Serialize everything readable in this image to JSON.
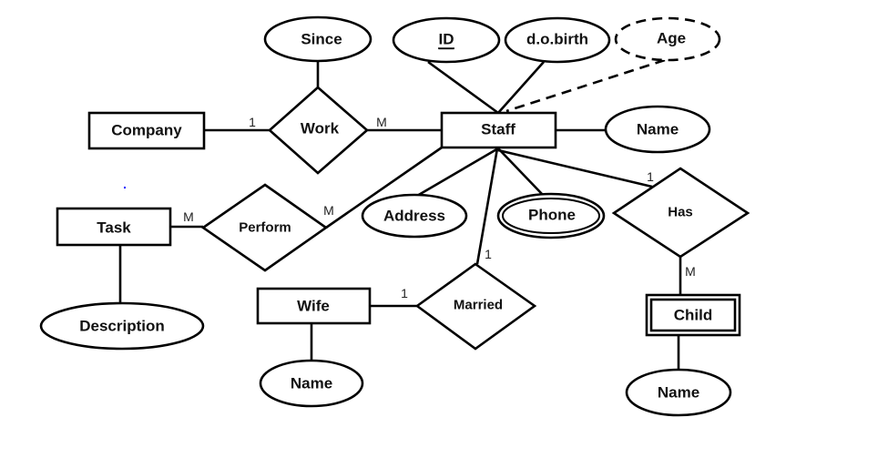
{
  "diagram": {
    "entities": {
      "company": "Company",
      "staff": "Staff",
      "task": "Task",
      "wife": "Wife",
      "child": "Child"
    },
    "relationships": {
      "work": "Work",
      "perform": "Perform",
      "married": "Married",
      "has": "Has"
    },
    "attributes": {
      "since": "Since",
      "id": "ID",
      "dob": "d.o.birth",
      "age": "Age",
      "staff_name": "Name",
      "address": "Address",
      "phone": "Phone",
      "description": "Description",
      "wife_name": "Name",
      "child_name": "Name"
    },
    "cardinalities": {
      "company_work": "1",
      "work_staff": "M",
      "task_perform": "M",
      "perform_staff": "M",
      "wife_married": "1",
      "married_staff": "1",
      "staff_has": "1",
      "has_child": "M"
    },
    "styles": {
      "line_color": "#000000",
      "accent_dot_color": "#0000ff"
    }
  }
}
